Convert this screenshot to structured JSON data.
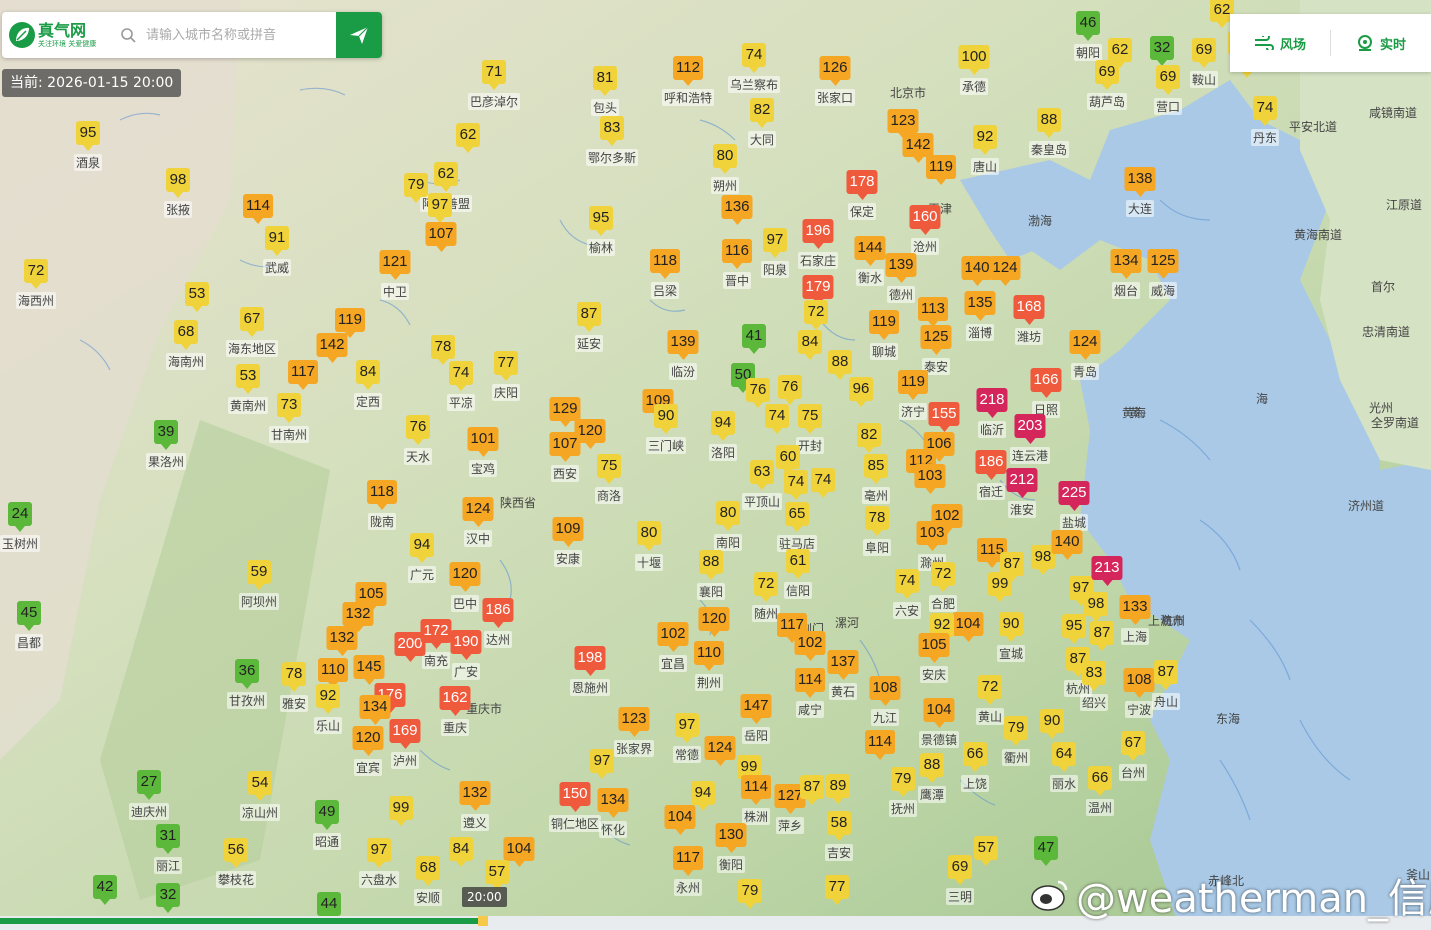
{
  "header": {
    "logo_name": "真气网",
    "logo_slogan": "关注环境 关爱健康",
    "search_placeholder": "请输入城市名称或拼音",
    "time_label": "当前: 2026-01-15 20:00"
  },
  "right_panel": {
    "wind_label": "风场",
    "realtime_label": "实时"
  },
  "timeline": {
    "current_label": "20:00"
  },
  "watermark": "@weatherman_信欣",
  "colors": {
    "brand": "#1a9b46",
    "good": "#5cb83a",
    "moderate": "#f0d23a",
    "sensitive": "#f5a623",
    "unhealthy": "#f05a3c",
    "very_unhealthy": "#d4265a",
    "sea": "#a9c9e6"
  },
  "aqi_markers": [
    {
      "v": 95,
      "c": "moderate",
      "city": "酒泉"
    },
    {
      "v": 98,
      "c": "moderate",
      "city": "张掖"
    },
    {
      "v": 114,
      "c": "sensitive",
      "city": ""
    },
    {
      "v": 91,
      "c": "moderate",
      "city": "武威"
    },
    {
      "v": 72,
      "c": "moderate",
      "city": "海西州"
    },
    {
      "v": 53,
      "c": "moderate",
      "city": ""
    },
    {
      "v": 68,
      "c": "moderate",
      "city": "海南州"
    },
    {
      "v": 67,
      "c": "moderate",
      "city": "海东地区"
    },
    {
      "v": 142,
      "c": "sensitive",
      "city": ""
    },
    {
      "v": 119,
      "c": "sensitive",
      "city": ""
    },
    {
      "v": 53,
      "c": "moderate",
      "city": "黄南州"
    },
    {
      "v": 117,
      "c": "sensitive",
      "city": ""
    },
    {
      "v": 84,
      "c": "moderate",
      "city": "定西"
    },
    {
      "v": 73,
      "c": "moderate",
      "city": "甘南州"
    },
    {
      "v": 39,
      "c": "good",
      "city": "果洛州"
    },
    {
      "v": 24,
      "c": "good",
      "city": "玉树州"
    },
    {
      "v": 45,
      "c": "good",
      "city": "昌都"
    },
    {
      "v": 59,
      "c": "moderate",
      "city": "阿坝州"
    },
    {
      "v": 36,
      "c": "good",
      "city": "甘孜州"
    },
    {
      "v": 27,
      "c": "good",
      "city": "迪庆州"
    },
    {
      "v": 31,
      "c": "good",
      "city": "丽江"
    },
    {
      "v": 42,
      "c": "good",
      "city": ""
    },
    {
      "v": 32,
      "c": "good",
      "city": ""
    },
    {
      "v": 44,
      "c": "good",
      "city": ""
    },
    {
      "v": 71,
      "c": "moderate",
      "city": "巴彦淖尔"
    },
    {
      "v": 81,
      "c": "moderate",
      "city": "包头"
    },
    {
      "v": 112,
      "c": "sensitive",
      "city": "呼和浩特"
    },
    {
      "v": 74,
      "c": "moderate",
      "city": "乌兰察布"
    },
    {
      "v": 126,
      "c": "sensitive",
      "city": "张家口"
    },
    {
      "v": 100,
      "c": "moderate",
      "city": "承德"
    },
    {
      "v": 46,
      "c": "good",
      "city": "朝阳"
    },
    {
      "v": 62,
      "c": "moderate",
      "city": ""
    },
    {
      "v": 32,
      "c": "good",
      "city": ""
    },
    {
      "v": 69,
      "c": "moderate",
      "city": "葫芦岛"
    },
    {
      "v": 69,
      "c": "moderate",
      "city": "营口"
    },
    {
      "v": 69,
      "c": "moderate",
      "city": "鞍山"
    },
    {
      "v": 62,
      "c": "moderate",
      "city": "阿拉善盟"
    },
    {
      "v": 79,
      "c": "moderate",
      "city": ""
    },
    {
      "v": 97,
      "c": "moderate",
      "city": ""
    },
    {
      "v": 107,
      "c": "sensitive",
      "city": ""
    },
    {
      "v": 62,
      "c": "moderate",
      "city": ""
    },
    {
      "v": 83,
      "c": "moderate",
      "city": "鄂尔多斯"
    },
    {
      "v": 82,
      "c": "moderate",
      "city": "大同"
    },
    {
      "v": 80,
      "c": "moderate",
      "city": "朔州"
    },
    {
      "v": 123,
      "c": "sensitive",
      "city": ""
    },
    {
      "v": 142,
      "c": "sensitive",
      "city": ""
    },
    {
      "v": 119,
      "c": "sensitive",
      "city": ""
    },
    {
      "v": 92,
      "c": "moderate",
      "city": "唐山"
    },
    {
      "v": 88,
      "c": "moderate",
      "city": "秦皇岛"
    },
    {
      "v": 74,
      "c": "moderate",
      "city": "丹东"
    },
    {
      "v": 138,
      "c": "sensitive",
      "city": "大连"
    },
    {
      "v": 121,
      "c": "sensitive",
      "city": "中卫"
    },
    {
      "v": 95,
      "c": "moderate",
      "city": "榆林"
    },
    {
      "v": 136,
      "c": "sensitive",
      "city": ""
    },
    {
      "v": 116,
      "c": "sensitive",
      "city": "晋中"
    },
    {
      "v": 97,
      "c": "moderate",
      "city": "阳泉"
    },
    {
      "v": 118,
      "c": "sensitive",
      "city": "吕梁"
    },
    {
      "v": 178,
      "c": "unhealthy",
      "city": "保定"
    },
    {
      "v": 196,
      "c": "unhealthy",
      "city": "石家庄"
    },
    {
      "v": 160,
      "c": "unhealthy",
      "city": "沧州"
    },
    {
      "v": 144,
      "c": "sensitive",
      "city": "衡水"
    },
    {
      "v": 139,
      "c": "sensitive",
      "city": "德州"
    },
    {
      "v": 179,
      "c": "unhealthy",
      "city": ""
    },
    {
      "v": 140,
      "c": "sensitive",
      "city": ""
    },
    {
      "v": 124,
      "c": "sensitive",
      "city": ""
    },
    {
      "v": 134,
      "c": "sensitive",
      "city": "烟台"
    },
    {
      "v": 125,
      "c": "sensitive",
      "city": "威海"
    },
    {
      "v": 87,
      "c": "moderate",
      "city": "延安"
    },
    {
      "v": 78,
      "c": "moderate",
      "city": ""
    },
    {
      "v": 74,
      "c": "moderate",
      "city": "平凉"
    },
    {
      "v": 77,
      "c": "moderate",
      "city": "庆阳"
    },
    {
      "v": 139,
      "c": "sensitive",
      "city": "临汾"
    },
    {
      "v": 41,
      "c": "good",
      "city": ""
    },
    {
      "v": 72,
      "c": "moderate",
      "city": ""
    },
    {
      "v": 84,
      "c": "moderate",
      "city": ""
    },
    {
      "v": 119,
      "c": "sensitive",
      "city": "聊城"
    },
    {
      "v": 113,
      "c": "sensitive",
      "city": ""
    },
    {
      "v": 135,
      "c": "sensitive",
      "city": "淄博"
    },
    {
      "v": 168,
      "c": "unhealthy",
      "city": "潍坊"
    },
    {
      "v": 125,
      "c": "sensitive",
      "city": "泰安"
    },
    {
      "v": 124,
      "c": "sensitive",
      "city": "青岛"
    },
    {
      "v": 76,
      "c": "moderate",
      "city": "天水"
    },
    {
      "v": 101,
      "c": "sensitive",
      "city": "宝鸡"
    },
    {
      "v": 129,
      "c": "sensitive",
      "city": ""
    },
    {
      "v": 120,
      "c": "sensitive",
      "city": ""
    },
    {
      "v": 107,
      "c": "sensitive",
      "city": "西安"
    },
    {
      "v": 109,
      "c": "sensitive",
      "city": ""
    },
    {
      "v": 90,
      "c": "moderate",
      "city": "三门峡"
    },
    {
      "v": 50,
      "c": "good",
      "city": ""
    },
    {
      "v": 76,
      "c": "moderate",
      "city": ""
    },
    {
      "v": 76,
      "c": "moderate",
      "city": ""
    },
    {
      "v": 88,
      "c": "moderate",
      "city": ""
    },
    {
      "v": 96,
      "c": "moderate",
      "city": ""
    },
    {
      "v": 74,
      "c": "moderate",
      "city": ""
    },
    {
      "v": 75,
      "c": "moderate",
      "city": "开封"
    },
    {
      "v": 119,
      "c": "sensitive",
      "city": "济宁"
    },
    {
      "v": 166,
      "c": "unhealthy",
      "city": "日照"
    },
    {
      "v": 218,
      "c": "very_unhealthy",
      "city": "临沂"
    },
    {
      "v": 155,
      "c": "unhealthy",
      "city": ""
    },
    {
      "v": 203,
      "c": "very_unhealthy",
      "city": "连云港"
    },
    {
      "v": 94,
      "c": "moderate",
      "city": "洛阳"
    },
    {
      "v": 75,
      "c": "moderate",
      "city": "商洛"
    },
    {
      "v": 82,
      "c": "moderate",
      "city": ""
    },
    {
      "v": 106,
      "c": "sensitive",
      "city": ""
    },
    {
      "v": 118,
      "c": "sensitive",
      "city": "陇南"
    },
    {
      "v": 124,
      "c": "sensitive",
      "city": "汉中"
    },
    {
      "v": 60,
      "c": "moderate",
      "city": ""
    },
    {
      "v": 63,
      "c": "moderate",
      "city": "平顶山"
    },
    {
      "v": 74,
      "c": "moderate",
      "city": ""
    },
    {
      "v": 74,
      "c": "moderate",
      "city": ""
    },
    {
      "v": 85,
      "c": "moderate",
      "city": "亳州"
    },
    {
      "v": 112,
      "c": "sensitive",
      "city": ""
    },
    {
      "v": 186,
      "c": "unhealthy",
      "city": "宿迁"
    },
    {
      "v": 212,
      "c": "very_unhealthy",
      "city": "淮安"
    },
    {
      "v": 225,
      "c": "very_unhealthy",
      "city": "盐城"
    },
    {
      "v": 103,
      "c": "sensitive",
      "city": ""
    },
    {
      "v": 109,
      "c": "sensitive",
      "city": "安康"
    },
    {
      "v": 80,
      "c": "moderate",
      "city": "十堰"
    },
    {
      "v": 80,
      "c": "moderate",
      "city": "南阳"
    },
    {
      "v": 65,
      "c": "moderate",
      "city": "驻马店"
    },
    {
      "v": 78,
      "c": "moderate",
      "city": "阜阳"
    },
    {
      "v": 102,
      "c": "sensitive",
      "city": ""
    },
    {
      "v": 103,
      "c": "sensitive",
      "city": "滁州"
    },
    {
      "v": 94,
      "c": "moderate",
      "city": "广元"
    },
    {
      "v": 120,
      "c": "sensitive",
      "city": "巴中"
    },
    {
      "v": 186,
      "c": "unhealthy",
      "city": "达州"
    },
    {
      "v": 88,
      "c": "moderate",
      "city": "襄阳"
    },
    {
      "v": 61,
      "c": "moderate",
      "city": "信阳"
    },
    {
      "v": 72,
      "c": "moderate",
      "city": "随州"
    },
    {
      "v": 74,
      "c": "moderate",
      "city": "六安"
    },
    {
      "v": 72,
      "c": "moderate",
      "city": "合肥"
    },
    {
      "v": 115,
      "c": "sensitive",
      "city": ""
    },
    {
      "v": 87,
      "c": "moderate",
      "city": ""
    },
    {
      "v": 98,
      "c": "moderate",
      "city": ""
    },
    {
      "v": 140,
      "c": "sensitive",
      "city": ""
    },
    {
      "v": 99,
      "c": "moderate",
      "city": ""
    },
    {
      "v": 97,
      "c": "moderate",
      "city": ""
    },
    {
      "v": 213,
      "c": "very_unhealthy",
      "city": ""
    },
    {
      "v": 105,
      "c": "sensitive",
      "city": ""
    },
    {
      "v": 132,
      "c": "sensitive",
      "city": ""
    },
    {
      "v": 132,
      "c": "sensitive",
      "city": ""
    },
    {
      "v": 200,
      "c": "unhealthy",
      "city": ""
    },
    {
      "v": 172,
      "c": "unhealthy",
      "city": "南充"
    },
    {
      "v": 190,
      "c": "unhealthy",
      "city": "广安"
    },
    {
      "v": 198,
      "c": "unhealthy",
      "city": "恩施州"
    },
    {
      "v": 102,
      "c": "sensitive",
      "city": "宜昌"
    },
    {
      "v": 120,
      "c": "sensitive",
      "city": ""
    },
    {
      "v": 110,
      "c": "sensitive",
      "city": "荆州"
    },
    {
      "v": 117,
      "c": "sensitive",
      "city": ""
    },
    {
      "v": 102,
      "c": "sensitive",
      "city": ""
    },
    {
      "v": 137,
      "c": "sensitive",
      "city": "黄石"
    },
    {
      "v": 104,
      "c": "sensitive",
      "city": ""
    },
    {
      "v": 90,
      "c": "moderate",
      "city": "宣城"
    },
    {
      "v": 95,
      "c": "moderate",
      "city": ""
    },
    {
      "v": 87,
      "c": "moderate",
      "city": ""
    },
    {
      "v": 98,
      "c": "moderate",
      "city": ""
    },
    {
      "v": 133,
      "c": "sensitive",
      "city": "上海"
    },
    {
      "v": 92,
      "c": "moderate",
      "city": ""
    },
    {
      "v": 105,
      "c": "sensitive",
      "city": "安庆"
    },
    {
      "v": 78,
      "c": "moderate",
      "city": "雅安"
    },
    {
      "v": 110,
      "c": "sensitive",
      "city": ""
    },
    {
      "v": 145,
      "c": "sensitive",
      "city": ""
    },
    {
      "v": 92,
      "c": "moderate",
      "city": "乐山"
    },
    {
      "v": 176,
      "c": "unhealthy",
      "city": ""
    },
    {
      "v": 134,
      "c": "sensitive",
      "city": ""
    },
    {
      "v": 162,
      "c": "unhealthy",
      "city": "重庆"
    },
    {
      "v": 120,
      "c": "sensitive",
      "city": "宜宾"
    },
    {
      "v": 169,
      "c": "unhealthy",
      "city": "泸州"
    },
    {
      "v": 114,
      "c": "sensitive",
      "city": "咸宁"
    },
    {
      "v": 108,
      "c": "sensitive",
      "city": "九江"
    },
    {
      "v": 104,
      "c": "sensitive",
      "city": "景德镇"
    },
    {
      "v": 72,
      "c": "moderate",
      "city": "黄山"
    },
    {
      "v": 87,
      "c": "moderate",
      "city": "杭州"
    },
    {
      "v": 83,
      "c": "moderate",
      "city": "绍兴"
    },
    {
      "v": 108,
      "c": "sensitive",
      "city": "宁波"
    },
    {
      "v": 87,
      "c": "moderate",
      "city": "舟山"
    },
    {
      "v": 123,
      "c": "sensitive",
      "city": "张家界"
    },
    {
      "v": 97,
      "c": "moderate",
      "city": "常德"
    },
    {
      "v": 147,
      "c": "sensitive",
      "city": "岳阳"
    },
    {
      "v": 124,
      "c": "sensitive",
      "city": ""
    },
    {
      "v": 114,
      "c": "sensitive",
      "city": ""
    },
    {
      "v": 79,
      "c": "moderate",
      "city": "衢州"
    },
    {
      "v": 90,
      "c": "moderate",
      "city": ""
    },
    {
      "v": 67,
      "c": "moderate",
      "city": "台州"
    },
    {
      "v": 54,
      "c": "moderate",
      "city": "凉山州"
    },
    {
      "v": 97,
      "c": "moderate",
      "city": ""
    },
    {
      "v": 99,
      "c": "moderate",
      "city": ""
    },
    {
      "v": 114,
      "c": "sensitive",
      "city": "株洲"
    },
    {
      "v": 127,
      "c": "sensitive",
      "city": "萍乡"
    },
    {
      "v": 87,
      "c": "moderate",
      "city": ""
    },
    {
      "v": 89,
      "c": "moderate",
      "city": ""
    },
    {
      "v": 88,
      "c": "moderate",
      "city": "鹰潭"
    },
    {
      "v": 66,
      "c": "moderate",
      "city": "上饶"
    },
    {
      "v": 64,
      "c": "moderate",
      "city": "丽水"
    },
    {
      "v": 66,
      "c": "moderate",
      "city": "温州"
    },
    {
      "v": 49,
      "c": "good",
      "city": "昭通"
    },
    {
      "v": 99,
      "c": "moderate",
      "city": ""
    },
    {
      "v": 132,
      "c": "sensitive",
      "city": "遵义"
    },
    {
      "v": 150,
      "c": "unhealthy",
      "city": "铜仁地区"
    },
    {
      "v": 134,
      "c": "sensitive",
      "city": "怀化"
    },
    {
      "v": 94,
      "c": "moderate",
      "city": ""
    },
    {
      "v": 104,
      "c": "sensitive",
      "city": ""
    },
    {
      "v": 130,
      "c": "sensitive",
      "city": "衡阳"
    },
    {
      "v": 58,
      "c": "moderate",
      "city": "吉安"
    },
    {
      "v": 79,
      "c": "moderate",
      "city": "抚州"
    },
    {
      "v": 56,
      "c": "moderate",
      "city": "攀枝花"
    },
    {
      "v": 97,
      "c": "moderate",
      "city": "六盘水"
    },
    {
      "v": 84,
      "c": "moderate",
      "city": ""
    },
    {
      "v": 104,
      "c": "sensitive",
      "city": ""
    },
    {
      "v": 68,
      "c": "moderate",
      "city": "安顺"
    },
    {
      "v": 57,
      "c": "moderate",
      "city": ""
    },
    {
      "v": 117,
      "c": "sensitive",
      "city": "永州"
    },
    {
      "v": 79,
      "c": "moderate",
      "city": ""
    },
    {
      "v": 77,
      "c": "moderate",
      "city": ""
    },
    {
      "v": 57,
      "c": "moderate",
      "city": ""
    },
    {
      "v": 69,
      "c": "moderate",
      "city": "三明"
    },
    {
      "v": 47,
      "c": "good",
      "city": ""
    },
    {
      "v": 62,
      "c": "moderate",
      "city": ""
    },
    {
      "v": 72,
      "c": "moderate",
      "city": ""
    },
    {
      "v": 55,
      "c": "moderate",
      "city": ""
    }
  ],
  "place_labels": [
    "北京市",
    "天津",
    "黄海",
    "渤海",
    "东海",
    "海",
    "济州道",
    "江原道",
    "黄海南道",
    "首尔",
    "忠清南道",
    "光州",
    "咸镜南道",
    "赤峰北",
    "平安北道",
    "黄",
    "釜山",
    "全罗南道",
    "陕西省",
    "重庆市",
    "杭州",
    "上海市",
    "荆门",
    "漯河"
  ]
}
